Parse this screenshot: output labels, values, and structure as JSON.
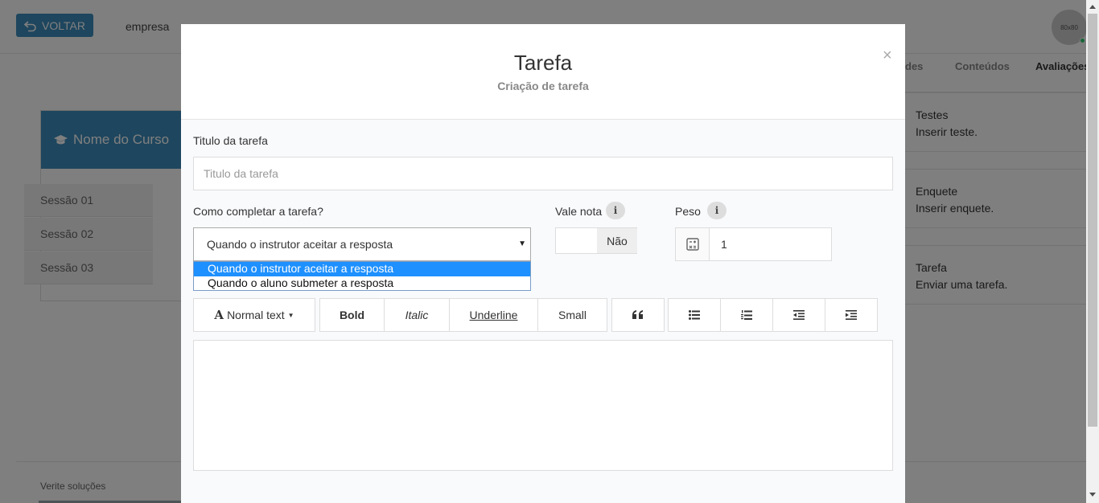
{
  "header": {
    "back_label": "VOLTAR",
    "company": "empresa",
    "avatar_text": "80x80"
  },
  "course": {
    "title": "Nome do Curso",
    "sessions": [
      "Sessão 01",
      "Sessão 02",
      "Sessão 03"
    ]
  },
  "tabs": {
    "partial": "des",
    "contents": "Conteúdos",
    "evaluations": "Avaliações"
  },
  "evaluations": [
    {
      "title": "Testes",
      "desc": "Inserir teste."
    },
    {
      "title": "Enquete",
      "desc": "Inserir enquete."
    },
    {
      "title": "Tarefa",
      "desc": "Enviar uma tarefa."
    }
  ],
  "footer": {
    "text": "Verite soluções"
  },
  "modal": {
    "title": "Tarefa",
    "subtitle": "Criação de tarefa",
    "close": "×",
    "task_title_label": "Titulo da tarefa",
    "task_title_placeholder": "Titulo da tarefa",
    "complete_label": "Como completar a tarefa?",
    "complete_selected": "Quando o instrutor aceitar a resposta",
    "complete_options": [
      "Quando o instrutor aceitar a resposta",
      "Quando o aluno submeter a resposta"
    ],
    "grade_label": "Vale nota",
    "grade_value": "Não",
    "weight_label": "Peso",
    "weight_value": "1",
    "info_glyph": "i",
    "toolbar": {
      "font_glyph": "A",
      "normal_text": "Normal text",
      "bold": "Bold",
      "italic": "Italic",
      "underline": "Underline",
      "small": "Small"
    }
  },
  "colors": {
    "primary": "#3c8dbc",
    "overlay": "rgba(0,0,0,0.5)",
    "option_highlight": "#1e90ff"
  },
  "icons": [
    "undo-icon",
    "graduation-cap-icon",
    "info-icon",
    "calculator-icon",
    "quote-icon",
    "unordered-list-icon",
    "ordered-list-icon",
    "outdent-icon",
    "indent-icon",
    "close-icon"
  ]
}
